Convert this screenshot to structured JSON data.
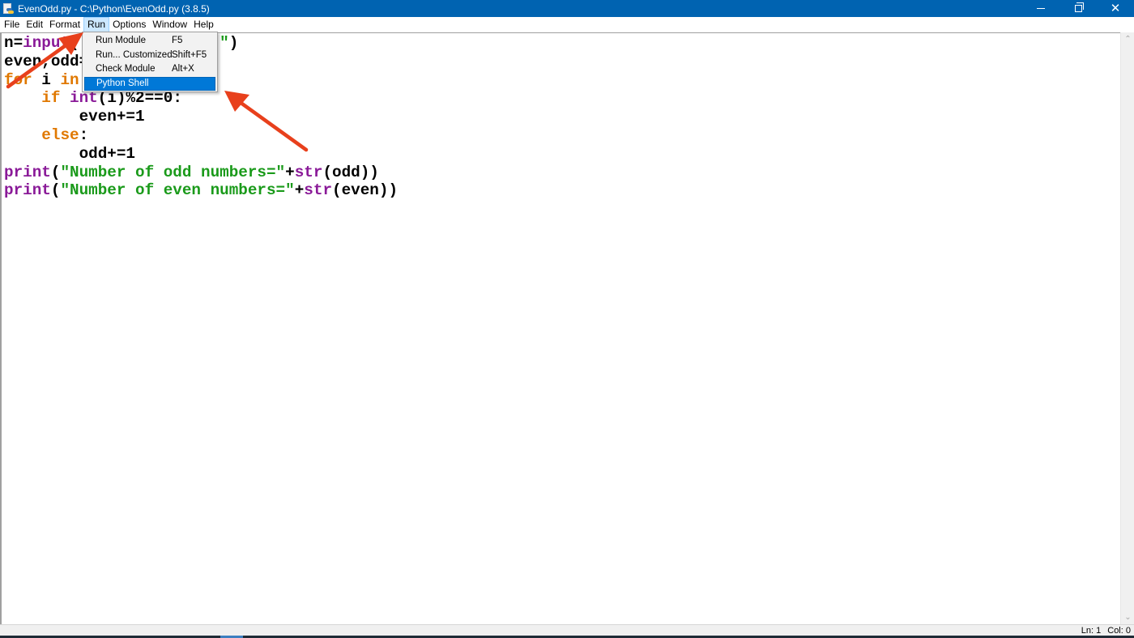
{
  "window": {
    "title": "EvenOdd.py - C:\\Python\\EvenOdd.py (3.8.5)",
    "controls": {
      "minimize": "minimize",
      "restore": "restore",
      "close": "✕"
    }
  },
  "menubar": {
    "items": [
      {
        "label": "File"
      },
      {
        "label": "Edit"
      },
      {
        "label": "Format"
      },
      {
        "label": "Run",
        "active": true
      },
      {
        "label": "Options"
      },
      {
        "label": "Window"
      },
      {
        "label": "Help"
      }
    ]
  },
  "run_menu": {
    "items": [
      {
        "label": "Run Module",
        "shortcut": "F5"
      },
      {
        "label": "Run... Customized",
        "shortcut": "Shift+F5"
      },
      {
        "label": "Check Module",
        "shortcut": "Alt+X"
      },
      {
        "label": "Python Shell",
        "shortcut": "",
        "selected": true
      }
    ]
  },
  "editor": {
    "lines": [
      [
        {
          "t": "n=",
          "c": ""
        },
        {
          "t": "input",
          "c": "bi"
        },
        {
          "t": "(               ",
          "c": ""
        },
        {
          "t": "\"",
          "c": "st"
        },
        {
          "t": ")",
          "c": ""
        }
      ],
      [
        {
          "t": "even,odd=",
          "c": ""
        }
      ],
      [
        {
          "t": "for",
          "c": "kw"
        },
        {
          "t": " i ",
          "c": ""
        },
        {
          "t": "in",
          "c": "kw"
        }
      ],
      [
        {
          "t": "    ",
          "c": ""
        },
        {
          "t": "if",
          "c": "kw"
        },
        {
          "t": " ",
          "c": ""
        },
        {
          "t": "int",
          "c": "bi"
        },
        {
          "t": "(i)%2==0:",
          "c": ""
        }
      ],
      [
        {
          "t": "        even+=1",
          "c": ""
        }
      ],
      [
        {
          "t": "    ",
          "c": ""
        },
        {
          "t": "else",
          "c": "kw"
        },
        {
          "t": ":",
          "c": ""
        }
      ],
      [
        {
          "t": "        odd+=1",
          "c": ""
        }
      ],
      [
        {
          "t": "print",
          "c": "bi"
        },
        {
          "t": "(",
          "c": ""
        },
        {
          "t": "\"Number of odd numbers=\"",
          "c": "st"
        },
        {
          "t": "+",
          "c": ""
        },
        {
          "t": "str",
          "c": "bi"
        },
        {
          "t": "(odd))",
          "c": ""
        }
      ],
      [
        {
          "t": "print",
          "c": "bi"
        },
        {
          "t": "(",
          "c": ""
        },
        {
          "t": "\"Number of even numbers=\"",
          "c": "st"
        },
        {
          "t": "+",
          "c": ""
        },
        {
          "t": "str",
          "c": "bi"
        },
        {
          "t": "(even))",
          "c": ""
        }
      ]
    ]
  },
  "scrollbar": {
    "up": "⌃",
    "down": "⌄"
  },
  "statusbar": {
    "line": "Ln: 1",
    "col": "Col: 0"
  },
  "annotations": {
    "color": "#e8401c"
  }
}
